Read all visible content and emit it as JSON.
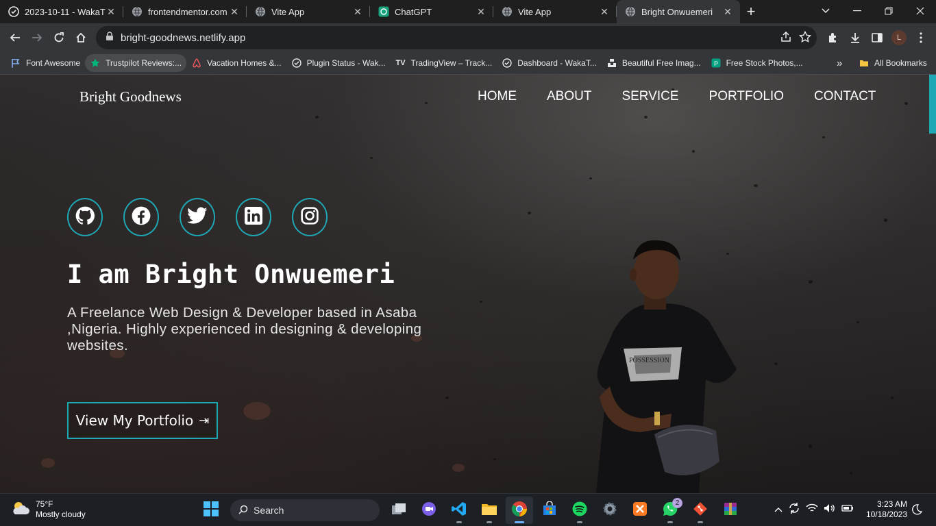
{
  "browser": {
    "tabs": [
      {
        "title": "2023-10-11 - WakaTi",
        "icon": "github-icon",
        "active": false
      },
      {
        "title": "frontendmentor.com",
        "icon": "globe-icon",
        "active": false
      },
      {
        "title": "Vite App",
        "icon": "globe-icon",
        "active": false
      },
      {
        "title": "ChatGPT",
        "icon": "chatgpt-icon",
        "active": false
      },
      {
        "title": "Vite App",
        "icon": "globe-icon",
        "active": false
      },
      {
        "title": "Bright Onwuemeri",
        "icon": "globe-icon",
        "active": true
      }
    ],
    "url": "bright-goodnews.netlify.app",
    "profile_initial": "L",
    "bookmarks": [
      {
        "label": "Font Awesome",
        "icon": "flag-icon"
      },
      {
        "label": "Trustpilot Reviews:...",
        "icon": "star-icon"
      },
      {
        "label": "Vacation Homes &...",
        "icon": "airbnb-icon"
      },
      {
        "label": "Plugin Status - Wak...",
        "icon": "wakatime-icon"
      },
      {
        "label": "TradingView – Track...",
        "icon": "tradingview-icon"
      },
      {
        "label": "Dashboard - WakaT...",
        "icon": "wakatime-icon"
      },
      {
        "label": "Beautiful Free Imag...",
        "icon": "unsplash-icon"
      },
      {
        "label": "Free Stock Photos,...",
        "icon": "pexels-icon"
      }
    ],
    "overflow_label": "»",
    "all_bookmarks": "All Bookmarks"
  },
  "site": {
    "brand": "Bright Goodnews",
    "nav": [
      "HOME",
      "ABOUT",
      "SERVICE",
      "PORTFOLIO",
      "CONTACT"
    ],
    "socials": [
      "github-icon",
      "facebook-icon",
      "twitter-icon",
      "linkedin-icon",
      "instagram-icon"
    ],
    "headline": "I am Bright Onwuemeri",
    "intro": "A Freelance Web Design & Developer based in Asaba ,Nigeria. Highly experienced in designing & developing websites.",
    "cta": "View My Portfolio",
    "cta_arrow": "⇥",
    "accent": "#1ea7b5"
  },
  "taskbar": {
    "weather_temp": "75°F",
    "weather_desc": "Mostly cloudy",
    "search_placeholder": "Search",
    "whatsapp_badge": "2",
    "time": "3:23 AM",
    "date": "10/18/2023"
  }
}
